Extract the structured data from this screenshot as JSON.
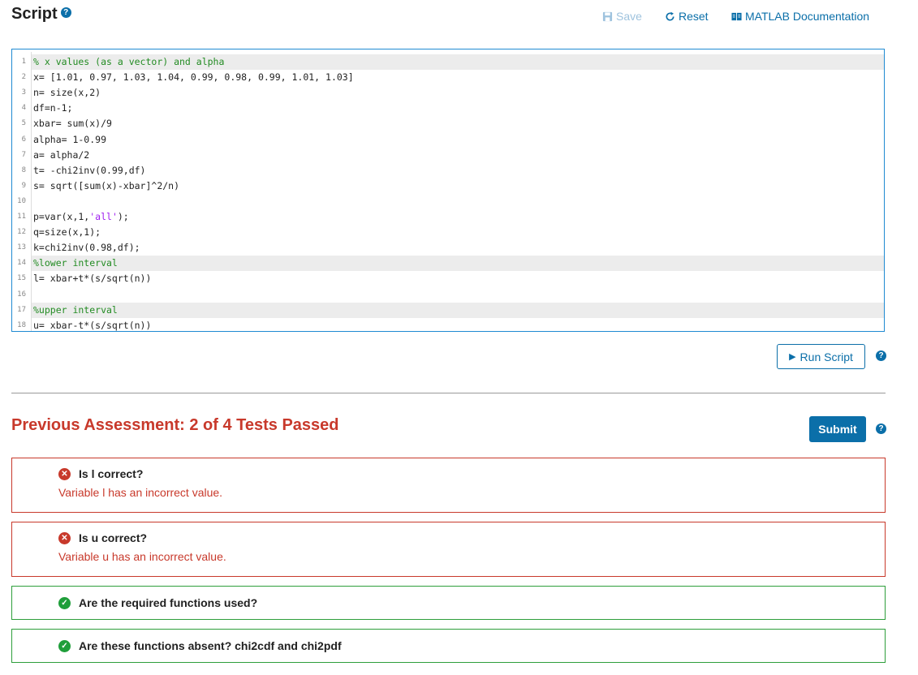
{
  "header": {
    "title": "Script",
    "help": "?",
    "save_label": "Save",
    "reset_label": "Reset",
    "doc_label": "MATLAB Documentation"
  },
  "editor": {
    "line_numbers": [
      "1",
      "2",
      "3",
      "4",
      "5",
      "6",
      "7",
      "8",
      "9",
      "10",
      "11",
      "12",
      "13",
      "14",
      "15",
      "16",
      "17",
      "18"
    ],
    "lines": [
      "% x values (as a vector) and alpha",
      "x= [1.01, 0.97, 1.03, 1.04, 0.99, 0.98, 0.99, 1.01, 1.03]",
      "n= size(x,2)",
      "df=n-1;",
      "xbar= sum(x)/9",
      "alpha= 1-0.99",
      "a= alpha/2",
      "t= -chi2inv(0.99,df)",
      "s= sqrt([sum(x)-xbar]^2/n)",
      "",
      "p=var(x,1,'all');",
      "q=size(x,1);",
      "k=chi2inv(0.98,df);",
      "%lower interval",
      "l= xbar+t*(s/sqrt(n))",
      "",
      "%upper interval",
      "u= xbar-t*(s/sqrt(n))"
    ]
  },
  "actions": {
    "run_label": "Run Script",
    "run_symbol": "▶",
    "submit_label": "Submit",
    "help": "?"
  },
  "assessment": {
    "title": "Previous Assessment: 2 of 4 Tests Passed",
    "tests": [
      {
        "name": "Is l correct?",
        "status": "fail",
        "message": "Variable l has an incorrect value."
      },
      {
        "name": "Is u correct?",
        "status": "fail",
        "message": "Variable u has an incorrect value."
      },
      {
        "name": "Are the required functions used?",
        "status": "pass",
        "message": ""
      },
      {
        "name": "Are these functions absent? chi2cdf and chi2pdf",
        "status": "pass",
        "message": ""
      }
    ]
  },
  "colors": {
    "accent": "#0b6fa9",
    "fail": "#c8392b",
    "pass": "#2e9e3b",
    "comment": "#228b22",
    "string": "#a020f0"
  }
}
